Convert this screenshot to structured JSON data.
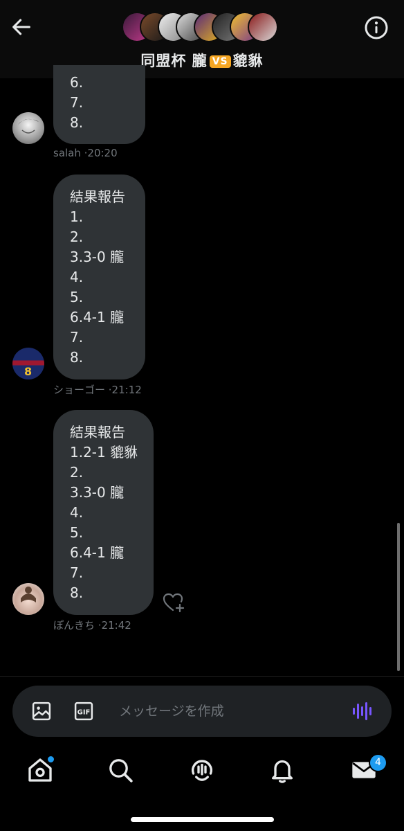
{
  "header": {
    "title_left": "同盟杯 朧",
    "vs_label": "VS",
    "title_right": "貔貅",
    "back_icon": "arrow-left-icon",
    "info_icon": "info-circle-icon",
    "group_avatar_icon": "group-avatars"
  },
  "messages": [
    {
      "lines": [
        "6.",
        "7.",
        "8."
      ],
      "sender": "salah",
      "time": " ·20:20"
    },
    {
      "lines": [
        "結果報告",
        "1.",
        "2.",
        "3.3-0 朧",
        "4.",
        "5.",
        "6.4-1 朧",
        "7.",
        "8."
      ],
      "sender": "ショーゴー",
      "time": " ·21:12"
    },
    {
      "lines": [
        "結果報告",
        "1.2-1 貔貅",
        "2.",
        "3.3-0 朧",
        "4.",
        "5.",
        "6.4-1 朧",
        "7.",
        "8."
      ],
      "sender": "ぽんきち",
      "time": " ·21:42"
    }
  ],
  "composer": {
    "placeholder": "メッセージを作成",
    "gif_label": "GIF"
  },
  "tabs": {
    "messages_badge": "4"
  },
  "colors": {
    "accent": "#1d9bf0",
    "bubble": "#2f3336",
    "voice": "#7856ff",
    "vs": "#f5a623"
  }
}
